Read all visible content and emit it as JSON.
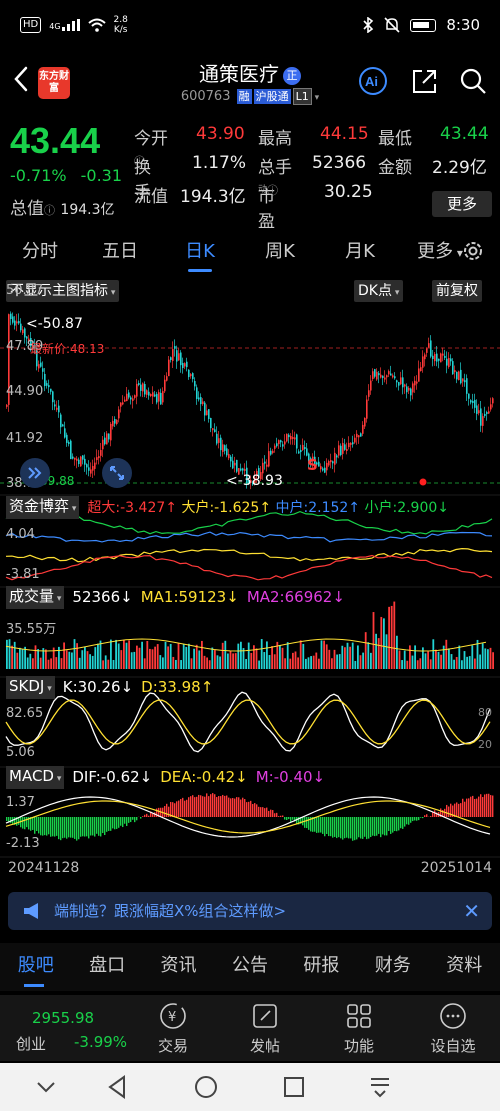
{
  "status_bar": {
    "net_badge": "HD",
    "signal": "4G",
    "speed_value": "2.8",
    "speed_unit": "K/s",
    "time": "8:30",
    "icons": [
      "bluetooth-icon",
      "mute-icon",
      "battery-icon"
    ]
  },
  "header": {
    "logo_text": "东方财富",
    "stock_name": "通策医疗",
    "name_badge": "正",
    "code": "600763",
    "tags": [
      "融",
      "沪股通",
      "L1"
    ],
    "icons": [
      "back-icon",
      "ai-icon",
      "share-icon",
      "search-icon"
    ]
  },
  "quote": {
    "price": "43.44",
    "change_pct": "-0.71%",
    "change": "-0.31",
    "cap_label": "总值",
    "cap_value": "194.3亿",
    "rows": [
      [
        {
          "label": "今开",
          "value": "43.90",
          "color": "red"
        },
        {
          "label": "最高",
          "value": "44.15",
          "color": "red"
        },
        {
          "label": "最低",
          "value": "43.44",
          "color": "green"
        }
      ],
      [
        {
          "label": "换手",
          "value": "1.17%",
          "color": "white"
        },
        {
          "label": "总手",
          "value": "52366",
          "color": "white"
        },
        {
          "label": "金额",
          "value": "2.29亿",
          "color": "white"
        }
      ],
      [
        {
          "label": "流值",
          "value": "194.3亿",
          "color": "white"
        },
        {
          "label": "市盈",
          "superscript": "动",
          "value": "30.25",
          "color": "white"
        }
      ]
    ],
    "more_label": "更多"
  },
  "period_tabs": [
    "分时",
    "五日",
    "日K",
    "周K",
    "月K",
    "更多"
  ],
  "active_period": "日K",
  "chart_toolbar": {
    "main_indicator": "不显示主图指标",
    "dk_label": "DK点",
    "adjust_label": "前复权"
  },
  "main_chart": {
    "y_labels": [
      "50.87",
      "47.89",
      "44.90",
      "41.92",
      "38.93"
    ],
    "max_marker": "<-50.87",
    "min_marker": "<-38.93",
    "cost_label": "最新价:48.13",
    "left_bottom_label": "39.88",
    "sell_marker": "S",
    "colors": {
      "up": "#ff3a3a",
      "down": "#22d3d3",
      "ma": "#ffffff"
    }
  },
  "fund_indicator": {
    "name": "资金博弈",
    "items": [
      {
        "label": "超大:-3.427",
        "arrow": "↑",
        "color": "#ff3a3a"
      },
      {
        "label": "大户:-1.625",
        "arrow": "↑",
        "color": "#ffe033"
      },
      {
        "label": "中户:2.152",
        "arrow": "↑",
        "color": "#3d8bff"
      },
      {
        "label": "小户:2.900",
        "arrow": "↓",
        "color": "#19d14a"
      }
    ],
    "y_top": "4.04",
    "y_bottom": "-3.81"
  },
  "volume_indicator": {
    "name": "成交量",
    "value": "52366",
    "value_arrow": "↓",
    "ma1": "MA1:59123",
    "ma1_arrow": "↓",
    "ma2": "MA2:66962",
    "ma2_arrow": "↓",
    "y_top": "35.55万"
  },
  "skdj_indicator": {
    "name": "SKDJ",
    "k": "K:30.26",
    "k_arrow": "↓",
    "d": "D:33.98",
    "d_arrow": "↑",
    "y_top": "82.65",
    "y_bottom": "5.06",
    "right_top": "80",
    "right_bottom": "20"
  },
  "macd_indicator": {
    "name": "MACD",
    "dif": "DIF:-0.62",
    "dif_arrow": "↓",
    "dea": "DEA:-0.42",
    "dea_arrow": "↓",
    "m": "M:-0.40",
    "m_arrow": "↓",
    "y_top": "1.37",
    "y_bottom": "-2.13"
  },
  "dates": {
    "start": "20241128",
    "end": "20251014"
  },
  "banner": {
    "text": "端制造？跟涨幅超X%组合这样做>",
    "close": "✕"
  },
  "section_tabs": [
    "股吧",
    "盘口",
    "资讯",
    "公告",
    "研报",
    "财务",
    "资料"
  ],
  "active_section": "股吧",
  "action_bar": {
    "index_value": "2955.98",
    "index_name": "创业",
    "index_pct": "-3.99%",
    "actions": [
      {
        "label": "交易",
        "icon": "trade-icon"
      },
      {
        "label": "发帖",
        "icon": "post-icon"
      },
      {
        "label": "功能",
        "icon": "function-icon"
      },
      {
        "label": "设自选",
        "icon": "add-watchlist-icon"
      }
    ]
  }
}
